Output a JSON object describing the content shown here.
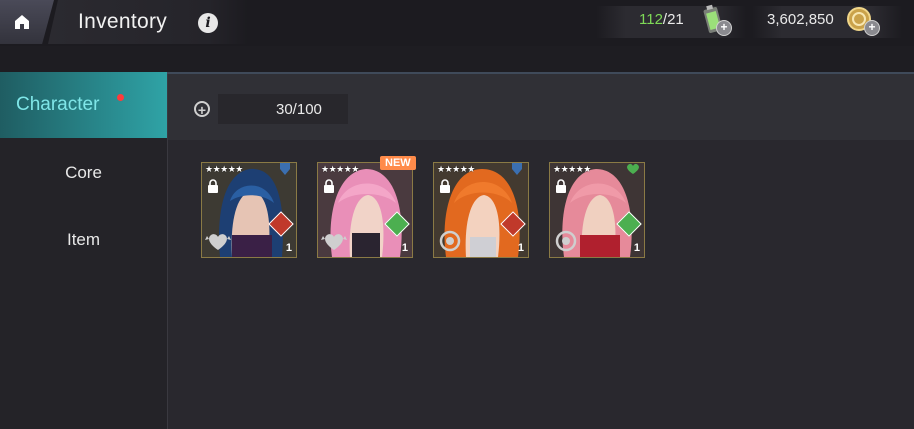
{
  "header": {
    "title": "Inventory",
    "info_icon": "i",
    "stamina": {
      "current": "112",
      "max": "/21",
      "icon": "battery-icon",
      "current_color": "#7ed957"
    },
    "gold": {
      "amount": "3,602,850",
      "icon": "coin-icon"
    }
  },
  "sidebar": {
    "items": [
      {
        "label": "Character",
        "active": true,
        "notification": true
      },
      {
        "label": "Core",
        "active": false
      },
      {
        "label": "Item",
        "active": false
      }
    ]
  },
  "capacity": {
    "count": "30/100"
  },
  "cards": [
    {
      "stars": "★★★★★",
      "count": "1",
      "type_color": "#3b6fb0",
      "class_color": "#c0392b",
      "element": "heart-wings-icon",
      "new": false
    },
    {
      "stars": "★★★★★",
      "count": "1",
      "type_color": "#3b6fb0",
      "class_color": "#4caf50",
      "element": "heart-wings-icon",
      "new": true,
      "new_label": "NEW"
    },
    {
      "stars": "★★★★★",
      "count": "1",
      "type_color": "#3b6fb0",
      "class_color": "#c0392b",
      "element": "ring-icon",
      "new": false
    },
    {
      "stars": "★★★★★",
      "count": "1",
      "type_color": "#4caf50",
      "class_color": "#4caf50",
      "element": "ring-icon",
      "new": false
    }
  ],
  "colors": {
    "accent": "#2a8e92",
    "active_text": "#7fe6e8",
    "notify": "#ff3b3b",
    "card_border": "#8a7a45"
  }
}
